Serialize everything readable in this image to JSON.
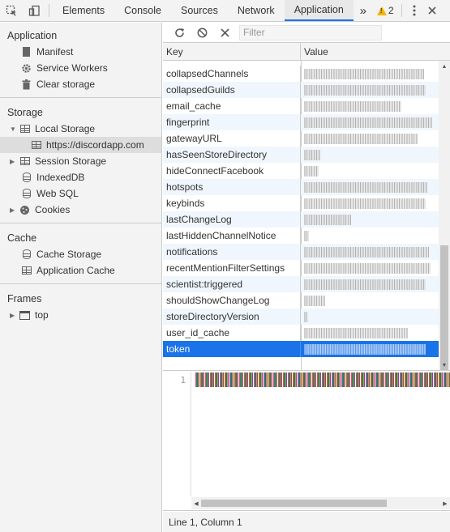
{
  "toolbar": {
    "tabs": [
      "Elements",
      "Console",
      "Sources",
      "Network",
      "Application"
    ],
    "active_tab": "Application",
    "warning_count": "2",
    "accent_color": "#1a73e8",
    "warning_color": "#f4b400"
  },
  "sidebar": {
    "sections": {
      "application": {
        "title": "Application",
        "items": [
          "Manifest",
          "Service Workers",
          "Clear storage"
        ]
      },
      "storage": {
        "title": "Storage",
        "local_storage": "Local Storage",
        "local_storage_origin": "https://discordapp.com",
        "session_storage": "Session Storage",
        "indexeddb": "IndexedDB",
        "websql": "Web SQL",
        "cookies": "Cookies"
      },
      "cache": {
        "title": "Cache",
        "items": [
          "Cache Storage",
          "Application Cache"
        ]
      },
      "frames": {
        "title": "Frames",
        "top": "top"
      }
    }
  },
  "filter": {
    "placeholder": "Filter"
  },
  "table": {
    "columns": [
      "Key",
      "Value"
    ],
    "rows": [
      {
        "key": "collapsedChannels"
      },
      {
        "key": "collapsedGuilds"
      },
      {
        "key": "email_cache"
      },
      {
        "key": "fingerprint"
      },
      {
        "key": "gatewayURL"
      },
      {
        "key": "hasSeenStoreDirectory"
      },
      {
        "key": "hideConnectFacebook"
      },
      {
        "key": "hotspots"
      },
      {
        "key": "keybinds"
      },
      {
        "key": "lastChangeLog"
      },
      {
        "key": "lastHiddenChannelNotice"
      },
      {
        "key": "notifications"
      },
      {
        "key": "recentMentionFilterSettings"
      },
      {
        "key": "scientist:triggered"
      },
      {
        "key": "shouldShowChangeLog"
      },
      {
        "key": "storeDirectoryVersion"
      },
      {
        "key": "user_id_cache"
      },
      {
        "key": "token"
      }
    ],
    "selected_key": "token"
  },
  "preview": {
    "line_number": "1",
    "first_char": "\""
  },
  "status": {
    "text": "Line 1, Column 1"
  }
}
